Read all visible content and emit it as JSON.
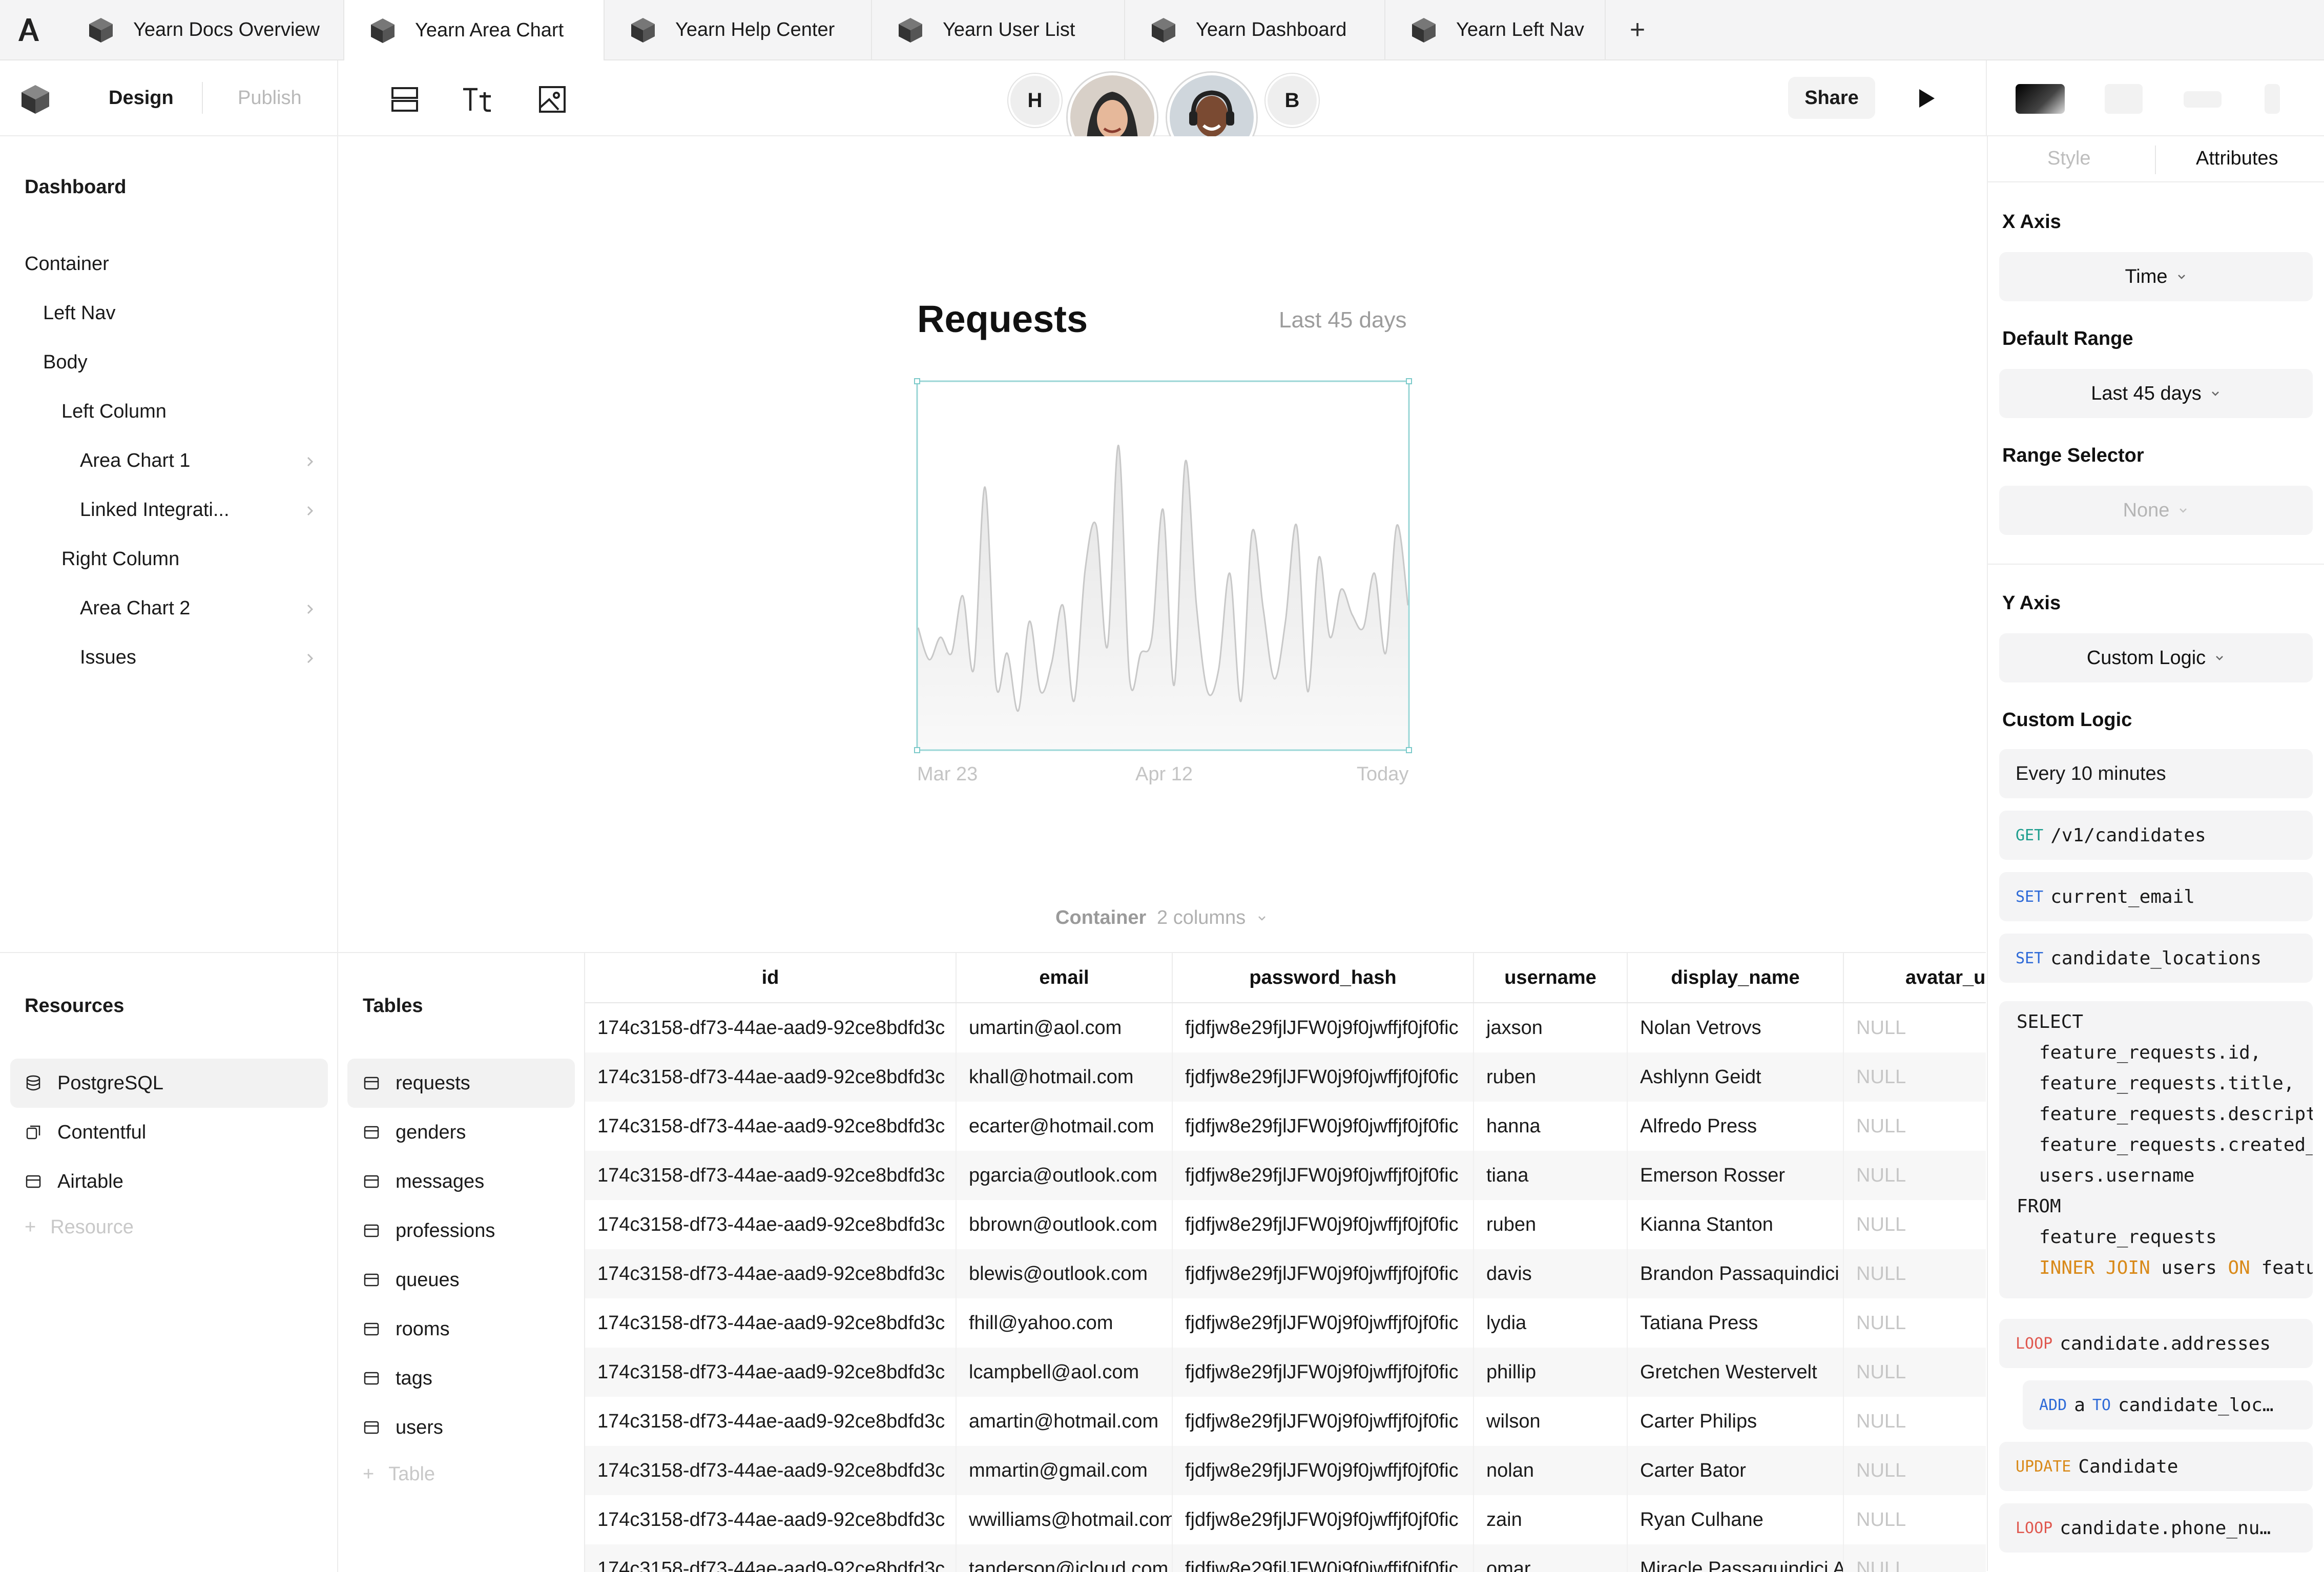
{
  "tabs": [
    {
      "label": "Yearn Docs Overview",
      "active": false
    },
    {
      "label": "Yearn Area Chart",
      "active": true
    },
    {
      "label": "Yearn Help Center",
      "active": false
    },
    {
      "label": "Yearn User List",
      "active": false
    },
    {
      "label": "Yearn Dashboard",
      "active": false
    },
    {
      "label": "Yearn Left Nav",
      "active": false
    }
  ],
  "toolbar": {
    "mode_design": "Design",
    "mode_publish": "Publish",
    "collaborators": [
      {
        "initial": "H"
      },
      {
        "initial": "B"
      }
    ],
    "share_label": "Share"
  },
  "navigator": {
    "root": "Dashboard",
    "items": [
      {
        "label": "Container",
        "has_chevron": false
      },
      {
        "label": "Left Nav",
        "has_chevron": false
      },
      {
        "label": "Body",
        "has_chevron": false
      },
      {
        "label": "Left Column",
        "has_chevron": false
      },
      {
        "label": "Area Chart 1",
        "has_chevron": true
      },
      {
        "label": "Linked Integrati...",
        "has_chevron": true
      },
      {
        "label": "Right Column",
        "has_chevron": false
      },
      {
        "label": "Area Chart 2",
        "has_chevron": true
      },
      {
        "label": "Issues",
        "has_chevron": true
      }
    ]
  },
  "canvas": {
    "container_label": "Container",
    "container_columns": "2 columns"
  },
  "chart_data": {
    "type": "area",
    "title": "Requests",
    "subtitle": "Last 45 days",
    "x_tick_labels": [
      "Mar 23",
      "Apr 12",
      "Today"
    ],
    "x": [
      0,
      1,
      2,
      3,
      4,
      5,
      6,
      7,
      8,
      9,
      10,
      11,
      12,
      13,
      14,
      15,
      16,
      17,
      18,
      19,
      20,
      21,
      22,
      23,
      24,
      25,
      26,
      27,
      28,
      29,
      30,
      31,
      32,
      33,
      34,
      35,
      36,
      37,
      38,
      39,
      40,
      41,
      42,
      43,
      44
    ],
    "values": [
      38,
      28,
      35,
      30,
      48,
      25,
      82,
      20,
      30,
      12,
      40,
      18,
      27,
      45,
      15,
      56,
      70,
      32,
      95,
      22,
      30,
      35,
      75,
      20,
      90,
      45,
      18,
      25,
      55,
      15,
      68,
      44,
      22,
      40,
      70,
      18,
      60,
      35,
      50,
      42,
      38,
      55,
      30,
      70,
      45
    ],
    "ylim": [
      0,
      110
    ],
    "grid": false,
    "legend": "none",
    "color": "#c8c8c8",
    "fill": "#ececec"
  },
  "resources": {
    "title": "Resources",
    "items": [
      {
        "label": "PostgreSQL",
        "icon": "database-icon",
        "selected": true
      },
      {
        "label": "Contentful",
        "icon": "contentful-icon",
        "selected": false
      },
      {
        "label": "Airtable",
        "icon": "airtable-icon",
        "selected": false
      }
    ],
    "add_label": "Resource"
  },
  "tables": {
    "title": "Tables",
    "items": [
      {
        "label": "requests",
        "selected": true
      },
      {
        "label": "genders",
        "selected": false
      },
      {
        "label": "messages",
        "selected": false
      },
      {
        "label": "professions",
        "selected": false
      },
      {
        "label": "queues",
        "selected": false
      },
      {
        "label": "rooms",
        "selected": false
      },
      {
        "label": "tags",
        "selected": false
      },
      {
        "label": "users",
        "selected": false
      }
    ],
    "add_label": "Table"
  },
  "grid": {
    "columns": [
      "id",
      "email",
      "password_hash",
      "username",
      "display_name",
      "avatar_url"
    ],
    "rows": [
      [
        "174c3158-df73-44ae-aad9-92ce8bdfd3c",
        "umartin@aol.com",
        "fjdfjw8e29fjlJFW0j9f0jwffjf0jf0fic",
        "jaxson",
        "Nolan Vetrovs",
        "NULL"
      ],
      [
        "174c3158-df73-44ae-aad9-92ce8bdfd3c",
        "khall@hotmail.com",
        "fjdfjw8e29fjlJFW0j9f0jwffjf0jf0fic",
        "ruben",
        "Ashlynn Geidt",
        "NULL"
      ],
      [
        "174c3158-df73-44ae-aad9-92ce8bdfd3c",
        "ecarter@hotmail.com",
        "fjdfjw8e29fjlJFW0j9f0jwffjf0jf0fic",
        "hanna",
        "Alfredo Press",
        "NULL"
      ],
      [
        "174c3158-df73-44ae-aad9-92ce8bdfd3c",
        "pgarcia@outlook.com",
        "fjdfjw8e29fjlJFW0j9f0jwffjf0jf0fic",
        "tiana",
        "Emerson Rosser",
        "NULL"
      ],
      [
        "174c3158-df73-44ae-aad9-92ce8bdfd3c",
        "bbrown@outlook.com",
        "fjdfjw8e29fjlJFW0j9f0jwffjf0jf0fic",
        "ruben",
        "Kianna Stanton",
        "NULL"
      ],
      [
        "174c3158-df73-44ae-aad9-92ce8bdfd3c",
        "blewis@outlook.com",
        "fjdfjw8e29fjlJFW0j9f0jwffjf0jf0fic",
        "davis",
        "Brandon Passaquindici",
        "NULL"
      ],
      [
        "174c3158-df73-44ae-aad9-92ce8bdfd3c",
        "fhill@yahoo.com",
        "fjdfjw8e29fjlJFW0j9f0jwffjf0jf0fic",
        "lydia",
        "Tatiana Press",
        "NULL"
      ],
      [
        "174c3158-df73-44ae-aad9-92ce8bdfd3c",
        "lcampbell@aol.com",
        "fjdfjw8e29fjlJFW0j9f0jwffjf0jf0fic",
        "phillip",
        "Gretchen Westervelt",
        "NULL"
      ],
      [
        "174c3158-df73-44ae-aad9-92ce8bdfd3c",
        "amartin@hotmail.com",
        "fjdfjw8e29fjlJFW0j9f0jwffjf0jf0fic",
        "wilson",
        "Carter Philips",
        "NULL"
      ],
      [
        "174c3158-df73-44ae-aad9-92ce8bdfd3c",
        "mmartin@gmail.com",
        "fjdfjw8e29fjlJFW0j9f0jwffjf0jf0fic",
        "nolan",
        "Carter Bator",
        "NULL"
      ],
      [
        "174c3158-df73-44ae-aad9-92ce8bdfd3c",
        "wwilliams@hotmail.com",
        "fjdfjw8e29fjlJFW0j9f0jwffjf0jf0fic",
        "zain",
        "Ryan Culhane",
        "NULL"
      ],
      [
        "174c3158-df73-44ae-aad9-92ce8bdfd3c",
        "tanderson@icloud.com",
        "fjdfjw8e29fjlJFW0j9f0jwffjf0jf0fic",
        "omar",
        "Miracle Passaquindici A",
        "NULL"
      ]
    ]
  },
  "inspector": {
    "tab_style": "Style",
    "tab_attributes": "Attributes",
    "x_axis_label": "X Axis",
    "x_axis_value": "Time",
    "default_range_label": "Default Range",
    "default_range_value": "Last 45 days",
    "range_selector_label": "Range Selector",
    "range_selector_value": "None",
    "y_axis_label": "Y Axis",
    "y_axis_value": "Custom Logic",
    "custom_logic_label": "Custom Logic",
    "schedule": "Every 10 minutes",
    "steps": [
      {
        "keyword": "GET",
        "text": "/v1/candidates"
      },
      {
        "keyword": "SET",
        "text": "current_email"
      },
      {
        "keyword": "SET",
        "text": "candidate_locations"
      }
    ],
    "sql": {
      "select_kw": "SELECT",
      "select_fields": [
        "feature_requests.id,",
        "feature_requests.title,",
        "feature_requests.descript",
        "feature_requests.created_",
        "users.username"
      ],
      "from_kw": "FROM",
      "from_table": "feature_requests",
      "join_kw": "INNER JOIN",
      "join_table": "users",
      "on_kw": "ON",
      "on_text": "featu"
    },
    "loop1_kw": "LOOP",
    "loop1_text": "candidate.addresses",
    "add_kw": "ADD",
    "add_var": "a",
    "to_kw": "TO",
    "add_target": "candidate_loc…",
    "update_kw": "UPDATE",
    "update_text": "Candidate",
    "loop2_kw": "LOOP",
    "loop2_text": "candidate.phone_nu…"
  }
}
